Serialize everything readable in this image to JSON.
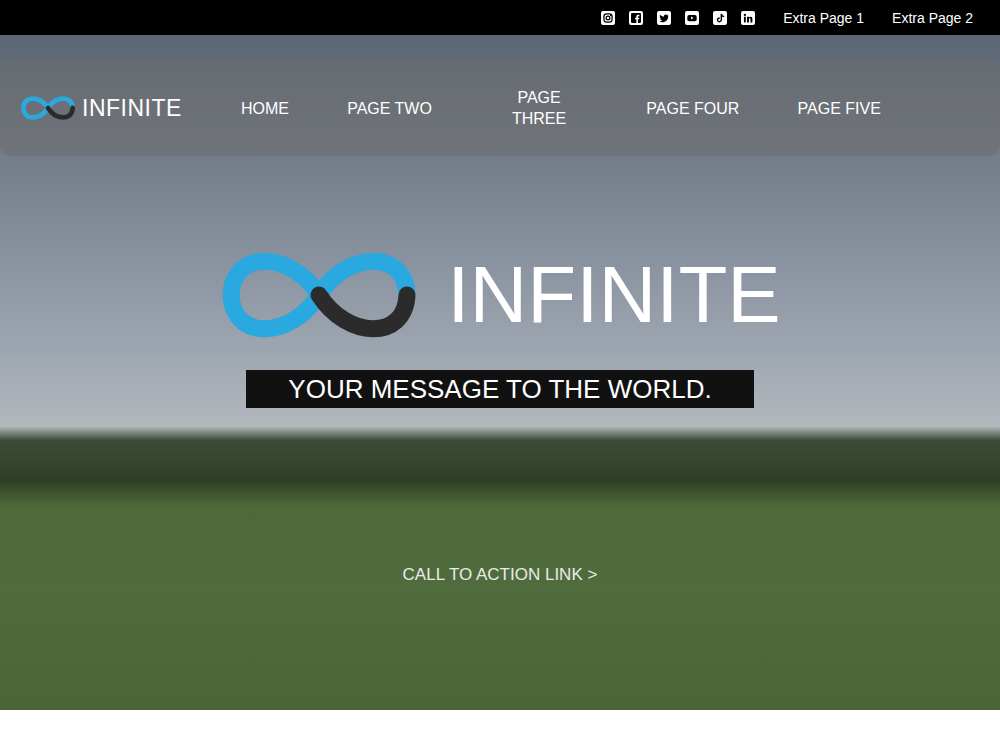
{
  "top_bar": {
    "links": [
      "Extra Page 1",
      "Extra Page 2"
    ]
  },
  "nav": {
    "logo": "INFINITE",
    "items": [
      "HOME",
      "PAGE TWO",
      "PAGE THREE",
      "PAGE FOUR",
      "PAGE FIVE"
    ]
  },
  "hero": {
    "logo": "INFINITE",
    "tagline": "YOUR MESSAGE TO THE WORLD.",
    "cta": "CALL TO ACTION LINK >"
  }
}
